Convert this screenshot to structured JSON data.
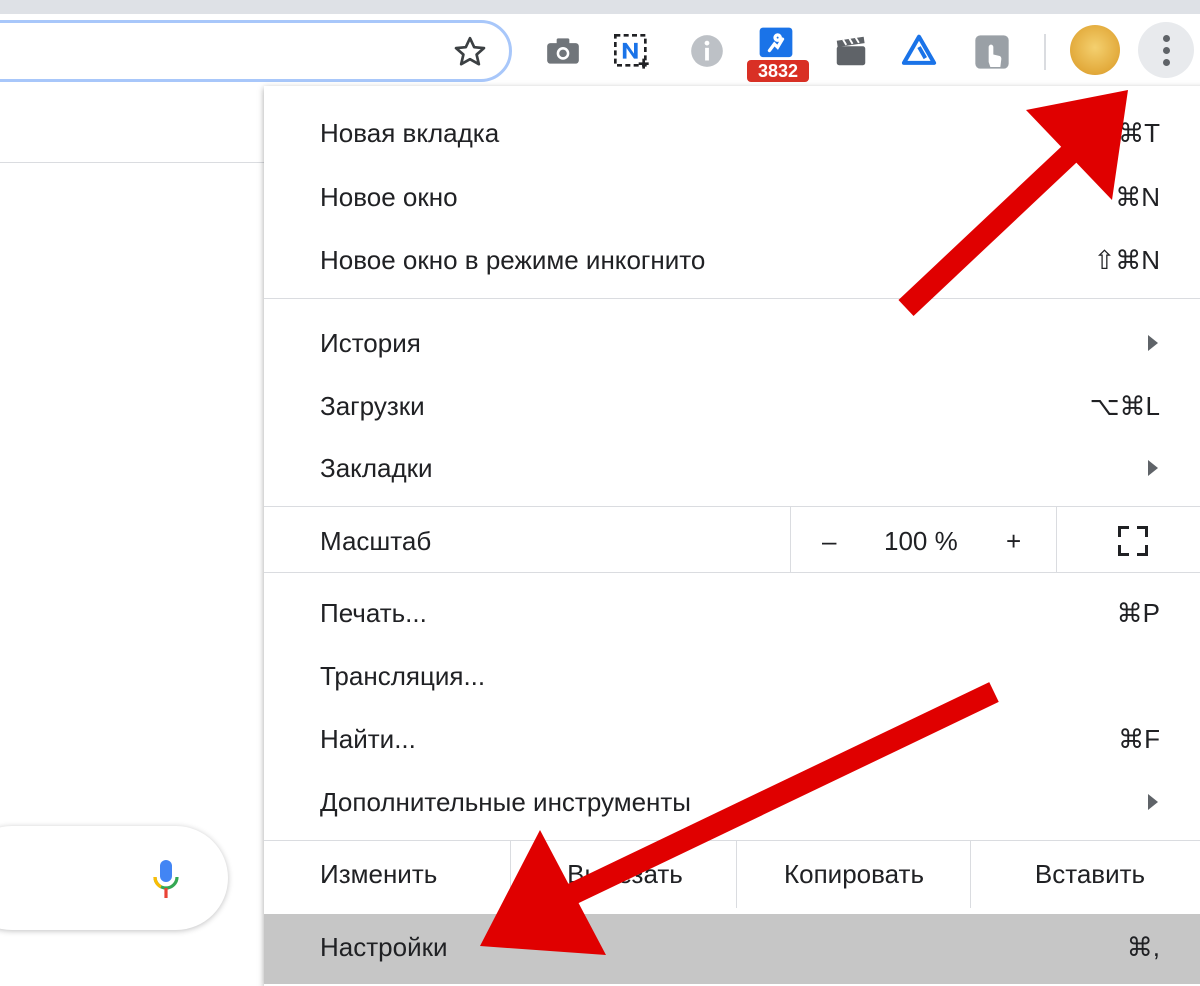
{
  "toolbar": {
    "badge_count": "3832"
  },
  "menu": {
    "group1": [
      {
        "label": "Новая вкладка",
        "shortcut": "⌘T"
      },
      {
        "label": "Новое окно",
        "shortcut": "⌘N"
      },
      {
        "label": "Новое окно в режиме инкогнито",
        "shortcut": "⇧⌘N"
      }
    ],
    "group2": [
      {
        "label": "История",
        "shortcut": ""
      },
      {
        "label": "Загрузки",
        "shortcut": "⌥⌘L"
      },
      {
        "label": "Закладки",
        "shortcut": ""
      }
    ],
    "zoom": {
      "label": "Масштаб",
      "minus": "–",
      "value": "100 %",
      "plus": "+"
    },
    "group3": [
      {
        "label": "Печать...",
        "shortcut": "⌘P"
      },
      {
        "label": "Трансляция...",
        "shortcut": ""
      },
      {
        "label": "Найти...",
        "shortcut": "⌘F"
      },
      {
        "label": "Дополнительные инструменты",
        "shortcut": ""
      }
    ],
    "edit": {
      "label": "Изменить",
      "cut": "Вырезать",
      "copy": "Копировать",
      "paste": "Вставить"
    },
    "settings": {
      "label": "Настройки",
      "shortcut": "⌘,"
    }
  },
  "colors": {
    "accent": "#a8c7fa",
    "badge": "#d93025",
    "annotation": "#e00000",
    "highlight": "#c6c6c6"
  }
}
